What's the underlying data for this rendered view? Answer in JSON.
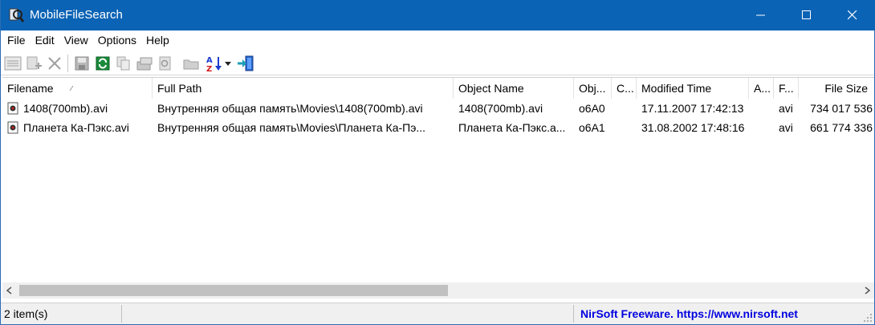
{
  "window": {
    "title": "MobileFileSearch"
  },
  "menu": [
    "File",
    "Edit",
    "View",
    "Options",
    "Help"
  ],
  "toolbar": {
    "icons": [
      "properties-icon",
      "add-icon",
      "delete-icon",
      "save-icon",
      "refresh-icon",
      "copy-icon",
      "html-report-icon",
      "find-icon",
      "open-folder-icon",
      "sort-icon",
      "exit-icon"
    ]
  },
  "table": {
    "columns": [
      "Filename",
      "Full Path",
      "Object Name",
      "Obj...",
      "C...",
      "Modified Time",
      "A...",
      "F...",
      "File Size"
    ],
    "rows": [
      [
        "1408(700mb).avi",
        "Внутренняя общая память\\Movies\\1408(700mb).avi",
        "1408(700mb).avi",
        "o6A0",
        "",
        "17.11.2007 17:42:13",
        "",
        "avi",
        "734 017 536"
      ],
      [
        "Планета Ка-Пэкс.avi",
        "Внутренняя общая память\\Movies\\Планета Ка-Пэ...",
        "Планета Ка-Пэкс.a...",
        "o6A1",
        "",
        "31.08.2002 17:48:16",
        "",
        "avi",
        "661 774 336"
      ]
    ]
  },
  "status": {
    "count": "2 item(s)",
    "credit": "NirSoft Freeware. https://www.nirsoft.net"
  },
  "colors": {
    "titlebar": "#0b63b5",
    "link": "#0000e0"
  }
}
